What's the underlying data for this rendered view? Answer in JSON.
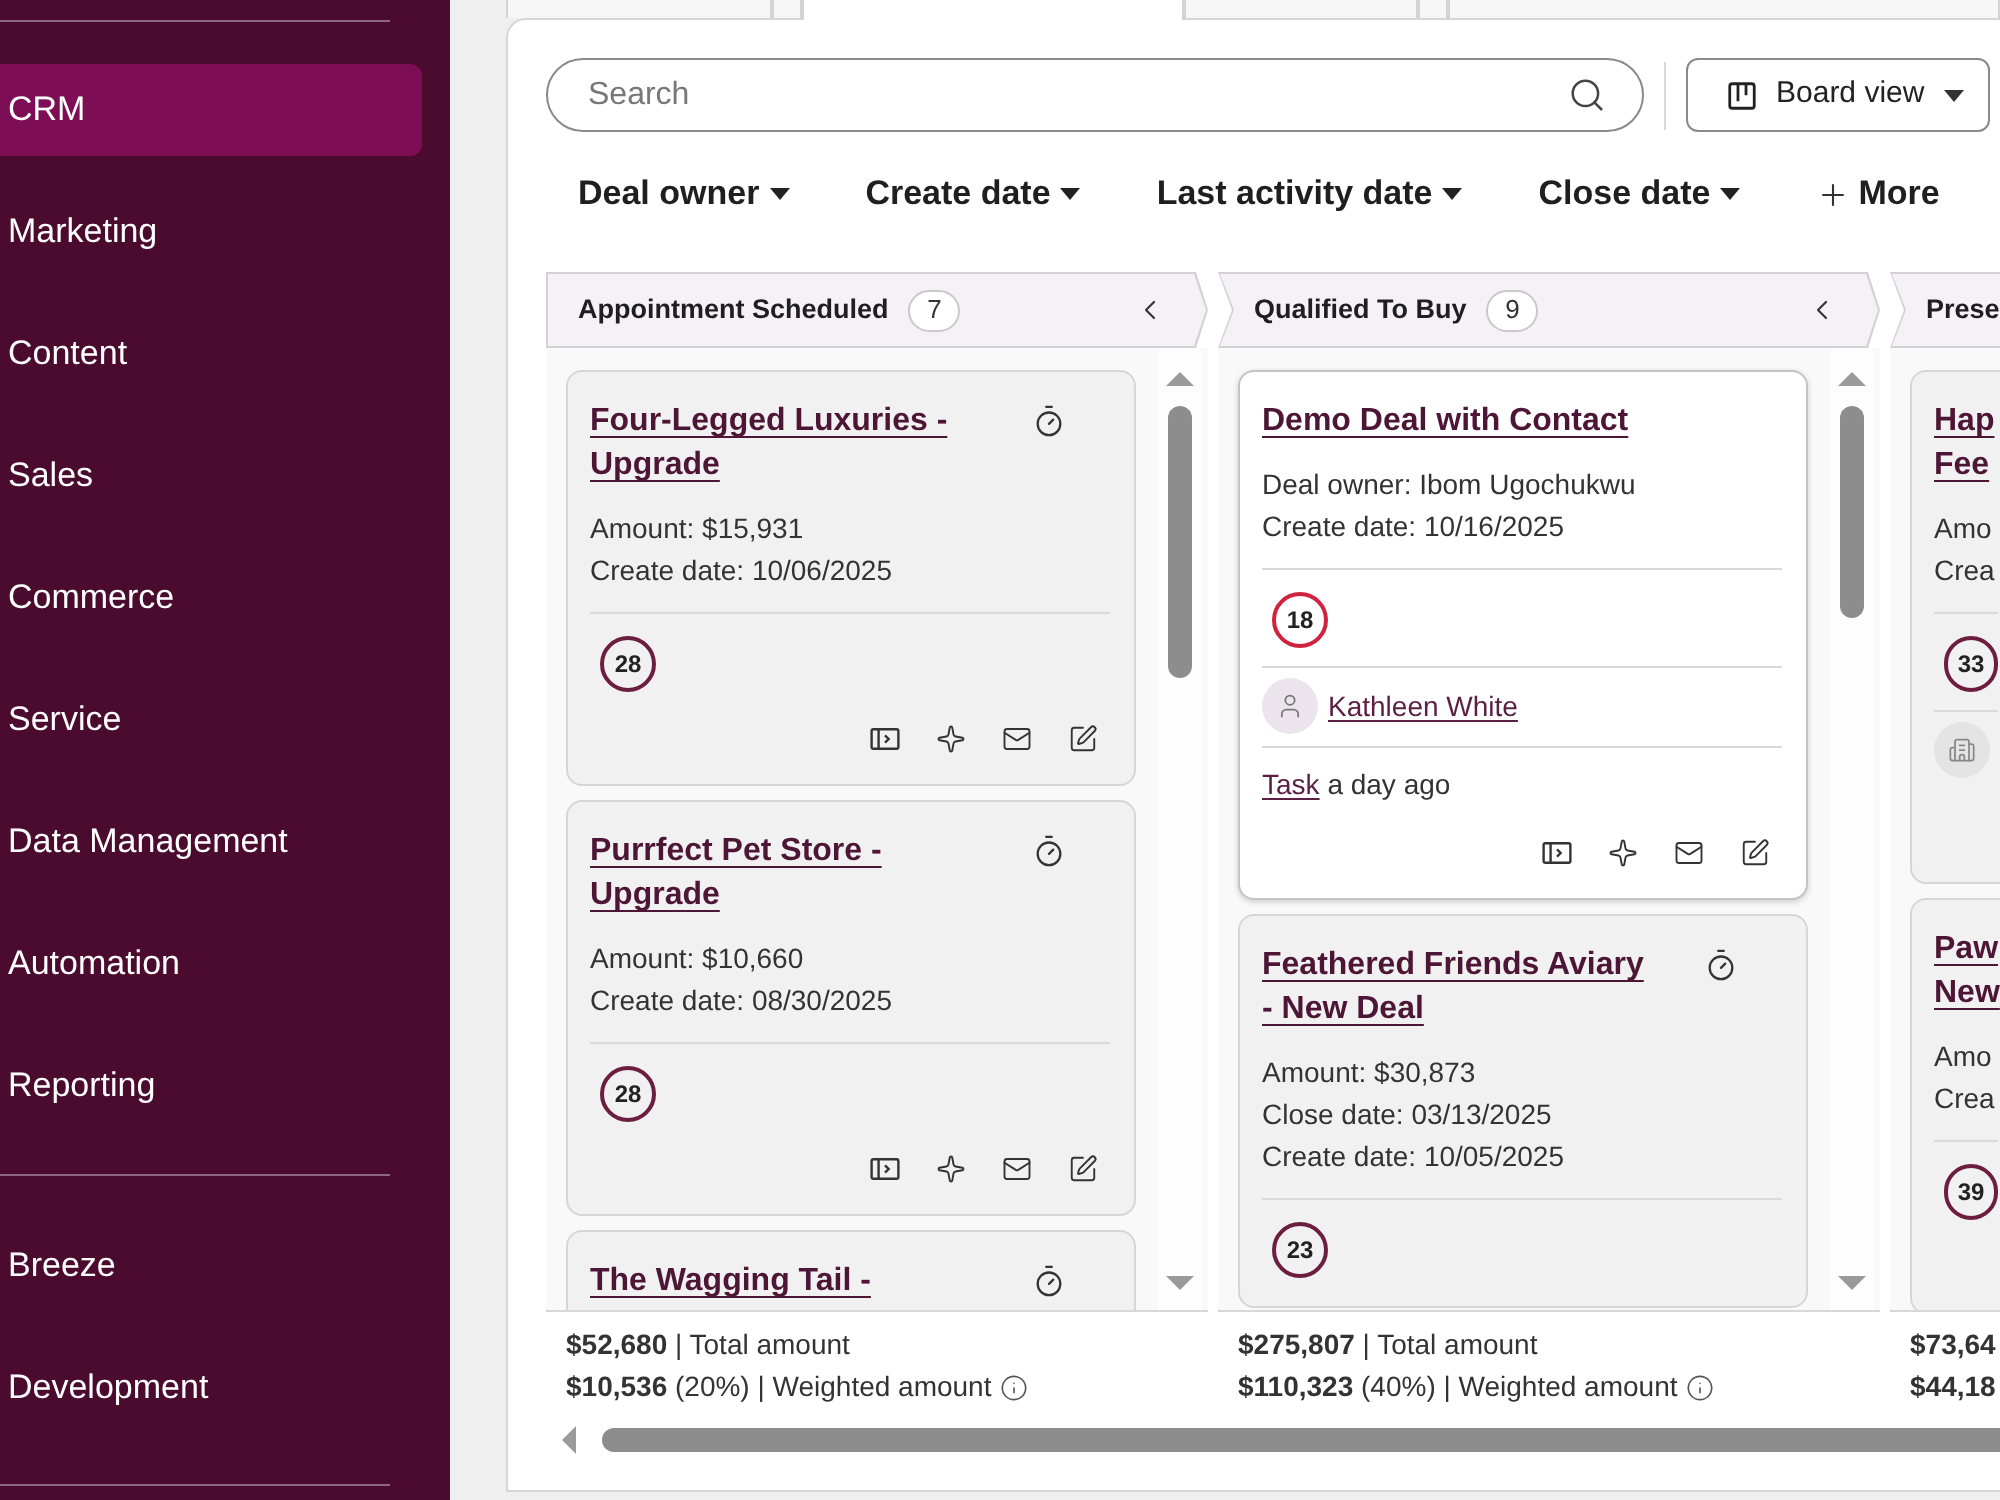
{
  "sidebar": {
    "groups": [
      {
        "items": [
          {
            "label": "CRM",
            "selected": true
          },
          {
            "label": "Marketing",
            "selected": false
          },
          {
            "label": "Content",
            "selected": false
          },
          {
            "label": "Sales",
            "selected": false
          },
          {
            "label": "Commerce",
            "selected": false
          },
          {
            "label": "Service",
            "selected": false
          },
          {
            "label": "Data Management",
            "selected": false
          },
          {
            "label": "Automation",
            "selected": false
          },
          {
            "label": "Reporting",
            "selected": false
          }
        ]
      },
      {
        "items": [
          {
            "label": "Breeze",
            "selected": false
          },
          {
            "label": "Development",
            "selected": false
          }
        ]
      }
    ]
  },
  "tabs": [
    {
      "selected": false
    },
    {
      "selected": false
    },
    {
      "selected": true
    },
    {
      "selected": false
    },
    {
      "selected": false
    },
    {
      "selected": false
    }
  ],
  "search": {
    "placeholder": "Search"
  },
  "view_button": {
    "label": "Board view"
  },
  "filters": [
    {
      "kind": "dropdown",
      "label": "Deal owner"
    },
    {
      "kind": "dropdown",
      "label": "Create date"
    },
    {
      "kind": "dropdown",
      "label": "Last activity date"
    },
    {
      "kind": "dropdown",
      "label": "Close date"
    },
    {
      "kind": "add",
      "label": "More"
    }
  ],
  "columns": [
    {
      "title": "Appointment Scheduled",
      "count": "7",
      "cards": [
        {
          "title": "Four-Legged Luxuries - Upgrade",
          "selected": false,
          "timer": true,
          "details": [
            "Amount: $15,931",
            "Create date: 10/06/2025"
          ],
          "badge": {
            "text": "28",
            "color": "#6b1e3f"
          },
          "actions": true
        },
        {
          "title": "Purrfect Pet Store - Upgrade",
          "selected": false,
          "timer": true,
          "details": [
            "Amount: $10,660",
            "Create date: 08/30/2025"
          ],
          "badge": {
            "text": "28",
            "color": "#6b1e3f"
          },
          "actions": true
        },
        {
          "title": "The Wagging Tail -",
          "selected": false,
          "timer": true
        }
      ],
      "footer": {
        "total": "**$52,680** | Total amount",
        "weighted": "**$10,536** (20%) | Weighted amount",
        "info": true
      }
    },
    {
      "title": "Qualified To Buy",
      "count": "9",
      "cards": [
        {
          "title": "Demo Deal with Contact",
          "selected": true,
          "timer": false,
          "details": [
            "Deal owner: Ibom Ugochukwu",
            "Create date: 10/16/2025"
          ],
          "badge": {
            "text": "18",
            "color": "#d0243e"
          },
          "contact": {
            "kind": "person",
            "name": "Kathleen White"
          },
          "activity": {
            "link": "Task",
            "text": "a day ago"
          },
          "actions": true
        },
        {
          "title": "Feathered Friends Aviary - New Deal",
          "selected": false,
          "timer": true,
          "details": [
            "Amount: $30,873",
            "Close date: 03/13/2025",
            "Create date: 10/05/2025"
          ],
          "badge": {
            "text": "23",
            "color": "#6b1e3f"
          }
        }
      ],
      "footer": {
        "total": "**$275,807** | Total amount",
        "weighted": "**$110,323** (40%) | Weighted amount",
        "info": true
      }
    },
    {
      "title": "Prese",
      "cards": [
        {
          "title": "Hap Fee",
          "selected": false,
          "details": [
            "Amo",
            "Crea"
          ],
          "badge": {
            "text": "33",
            "color": "#6b1e3f"
          },
          "contact": {
            "kind": "company"
          }
        },
        {
          "title": "Paw New",
          "selected": false,
          "details": [
            "Amo",
            "Crea"
          ],
          "badge": {
            "text": "39",
            "color": "#6b1e3f"
          }
        }
      ],
      "footer": {
        "total": "**$73,64**",
        "weighted": "**$44,18**"
      }
    }
  ]
}
